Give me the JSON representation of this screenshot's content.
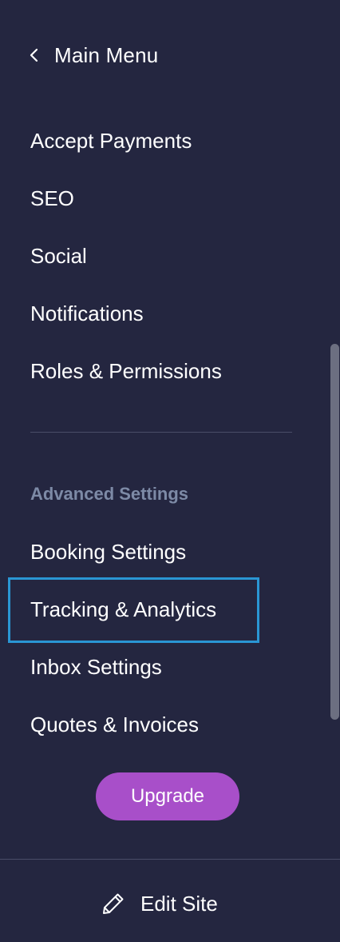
{
  "nav": {
    "back_label": "Main Menu",
    "back_icon": "chevron-left-icon"
  },
  "settings": {
    "items": [
      {
        "label": "Accept Payments"
      },
      {
        "label": "SEO"
      },
      {
        "label": "Social"
      },
      {
        "label": "Notifications"
      },
      {
        "label": "Roles & Permissions"
      }
    ]
  },
  "advanced": {
    "header": "Advanced Settings",
    "items": [
      {
        "label": "Booking Settings"
      },
      {
        "label": "Tracking & Analytics",
        "focused": true
      },
      {
        "label": "Inbox Settings"
      },
      {
        "label": "Quotes & Invoices"
      }
    ]
  },
  "upgrade": {
    "label": "Upgrade",
    "color": "#a84fc9"
  },
  "footer": {
    "edit_label": "Edit Site",
    "edit_icon": "pencil-icon"
  },
  "colors": {
    "background": "#242640",
    "focus_outline": "#2a96d4",
    "section_header": "#7d8aa6"
  }
}
